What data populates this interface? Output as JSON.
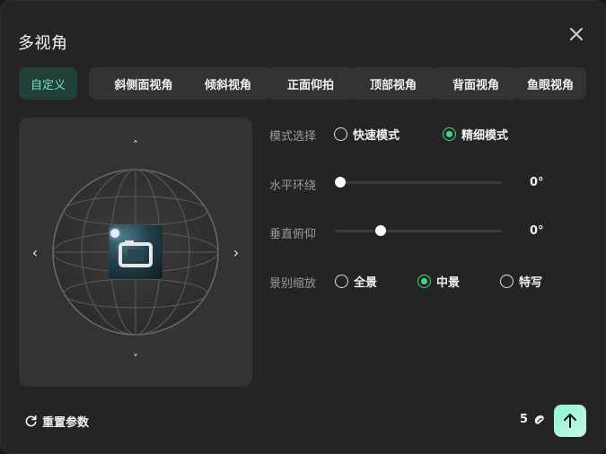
{
  "dialog": {
    "title": "多视角",
    "close_icon": "close-icon"
  },
  "tabs": [
    {
      "label": "自定义",
      "active": true
    },
    {
      "label": "斜侧面视角",
      "active": false
    },
    {
      "label": "倾斜视角",
      "active": false
    },
    {
      "label": "正面仰拍",
      "active": false
    },
    {
      "label": "顶部视角",
      "active": false
    },
    {
      "label": "背面视角",
      "active": false
    },
    {
      "label": "鱼眼视角",
      "active": false
    }
  ],
  "viewer": {
    "arrow_up": "˄",
    "arrow_down": "˅",
    "arrow_left": "‹",
    "arrow_right": "›",
    "camera_icon": "camera-icon",
    "globe_icon": "wireframe-sphere-icon"
  },
  "mode": {
    "label": "模式选择",
    "options": [
      {
        "label": "快速模式",
        "checked": false
      },
      {
        "label": "精细模式",
        "checked": true
      }
    ]
  },
  "horizontal": {
    "label": "水平环绕",
    "value_text": "0°",
    "fraction": 0.0
  },
  "vertical": {
    "label": "垂直俯仰",
    "value_text": "0°",
    "fraction": 0.26
  },
  "shot": {
    "label": "景别缩放",
    "options": [
      {
        "label": "全景",
        "checked": false
      },
      {
        "label": "中景",
        "checked": true
      },
      {
        "label": "特写",
        "checked": false
      }
    ]
  },
  "footer": {
    "reset_label": "重置参数",
    "reset_icon": "refresh-icon",
    "credits": "5",
    "credits_icon": "bean-icon",
    "submit_icon": "arrow-up-icon"
  },
  "colors": {
    "accent_green": "#3ddc84",
    "active_tab_text": "#6fe3c8",
    "submit_gradient_start": "#8ff5d2"
  }
}
